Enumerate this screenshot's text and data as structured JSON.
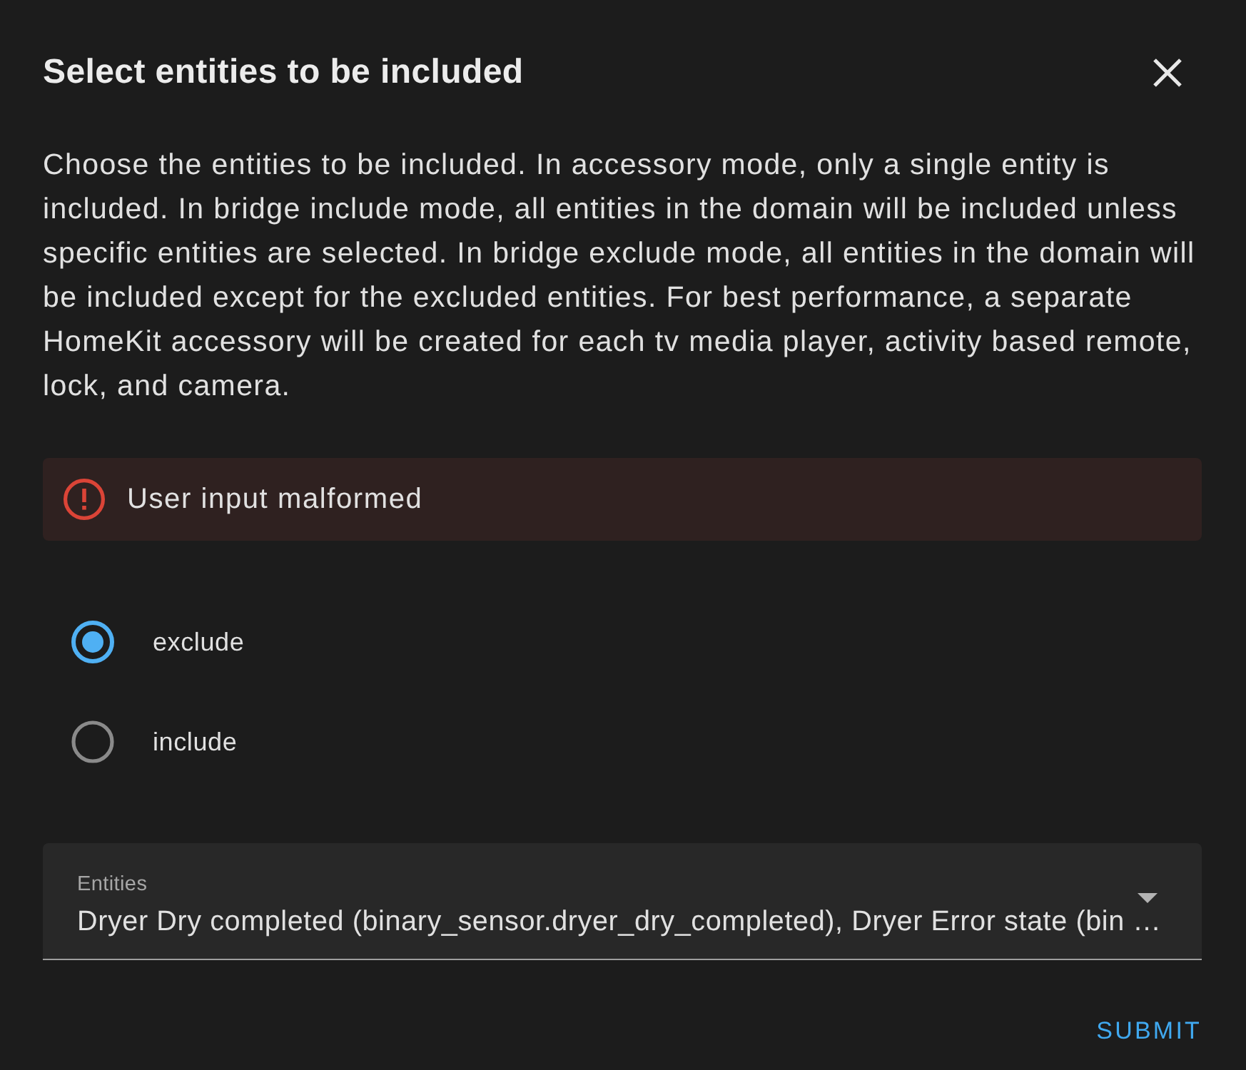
{
  "dialog": {
    "title": "Select entities to be included",
    "description": "Choose the entities to be included. In accessory mode, only a single entity is included. In bridge include mode, all entities in the domain will be included unless specific entities are selected. In bridge exclude mode, all entities in the domain will be included except for the excluded entities. For best performance, a separate HomeKit accessory will be created for each tv media player, activity based remote, lock, and camera.",
    "error": {
      "message": "User input malformed"
    },
    "mode_options": [
      {
        "label": "exclude",
        "selected": true
      },
      {
        "label": "include",
        "selected": false
      }
    ],
    "entities_field": {
      "label": "Entities",
      "value": "Dryer Dry completed (binary_sensor.dryer_dry_completed), Dryer Error state (bin …"
    },
    "buttons": [
      "SUBMIT"
    ]
  }
}
